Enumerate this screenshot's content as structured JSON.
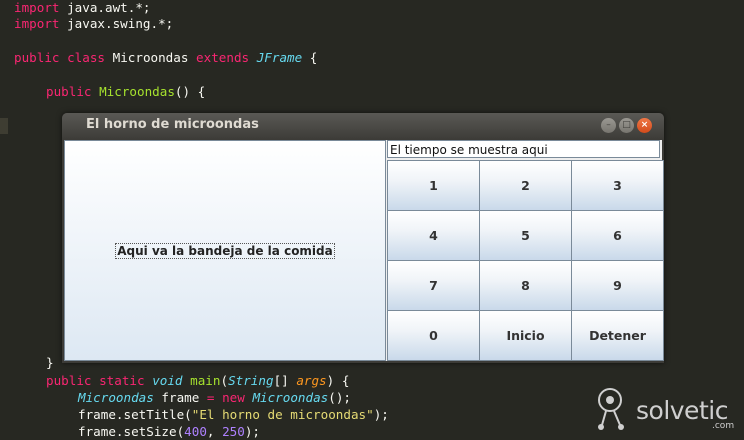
{
  "code": {
    "line1": {
      "kw": "import",
      "rest": " java.awt.*;"
    },
    "line2": {
      "kw": "import",
      "rest": " javax.swing.*;"
    },
    "line4": {
      "kw1": "public",
      "kw2": "class",
      "name": "Microondas",
      "kw3": "extends",
      "type": "JFrame",
      "tail": "{"
    },
    "line6": {
      "kw": "public",
      "fn": "Microondas",
      "tail": "() {"
    },
    "line_close": "}",
    "line_main": {
      "kw1": "public",
      "kw2": "static",
      "type": "void",
      "fn": "main",
      "p1": "(",
      "t1": "String",
      "p2": "[] ",
      "arg": "args",
      "tail": ") {"
    },
    "line_frame": {
      "type": "Microondas",
      "mid": " frame ",
      "op": "=",
      "kw": "new",
      "type2": "Microondas",
      "tail": "();"
    },
    "line_title": {
      "pre": "frame.setTitle(",
      "str": "\"El horno de microondas\"",
      "tail": ");"
    },
    "line_size": {
      "pre": "frame.setSize(",
      "n1": "400",
      "sep": ", ",
      "n2": "250",
      "tail": ");"
    }
  },
  "window": {
    "title": "El horno de microondas",
    "tray_label": "Aqui va la bandeja de la comida",
    "time_display": "El tiempo se muestra aqui",
    "keys": [
      "1",
      "2",
      "3",
      "4",
      "5",
      "6",
      "7",
      "8",
      "9",
      "0",
      "Inicio",
      "Detener"
    ]
  },
  "logo": {
    "text": "solvetic",
    "suffix": ".com"
  }
}
